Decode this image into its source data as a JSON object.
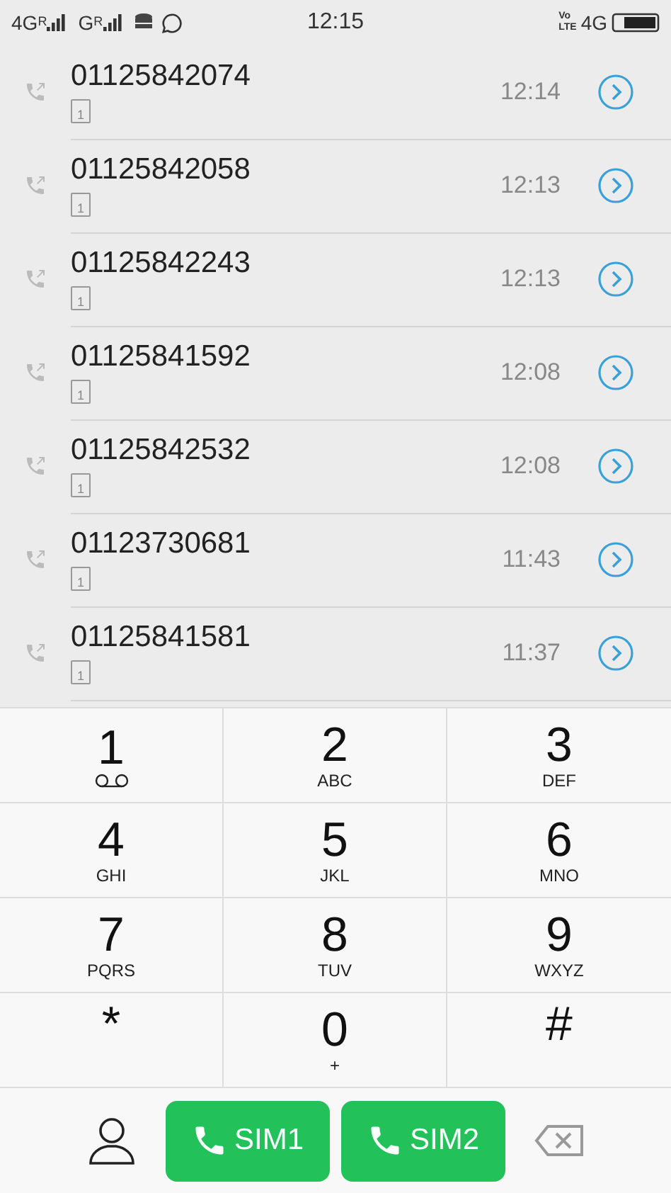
{
  "status_bar": {
    "networks": [
      {
        "type": "4G",
        "roaming": "R"
      },
      {
        "type": "G",
        "roaming": "R"
      }
    ],
    "time": "12:15",
    "volte": [
      "Vo",
      "LTE"
    ],
    "data_type": "4G"
  },
  "calls": [
    {
      "number": "01125842074",
      "time": "12:14",
      "sim": "1"
    },
    {
      "number": "01125842058",
      "time": "12:13",
      "sim": "1"
    },
    {
      "number": "01125842243",
      "time": "12:13",
      "sim": "1"
    },
    {
      "number": "01125841592",
      "time": "12:08",
      "sim": "1"
    },
    {
      "number": "01125842532",
      "time": "12:08",
      "sim": "1"
    },
    {
      "number": "01123730681",
      "time": "11:43",
      "sim": "1"
    },
    {
      "number": "01125841581",
      "time": "11:37",
      "sim": "1"
    }
  ],
  "keypad": [
    {
      "kind": "voicemail",
      "key": "1"
    },
    {
      "kind": "letters",
      "key": "2",
      "sub": "ABC"
    },
    {
      "kind": "letters",
      "key": "3",
      "sub": "DEF"
    },
    {
      "kind": "letters",
      "key": "4",
      "sub": "GHI"
    },
    {
      "kind": "letters",
      "key": "5",
      "sub": "JKL"
    },
    {
      "kind": "letters",
      "key": "6",
      "sub": "MNO"
    },
    {
      "kind": "letters",
      "key": "7",
      "sub": "PQRS"
    },
    {
      "kind": "letters",
      "key": "8",
      "sub": "TUV"
    },
    {
      "kind": "letters",
      "key": "9",
      "sub": "WXYZ"
    },
    {
      "kind": "symbol",
      "key": "*"
    },
    {
      "kind": "letters",
      "key": "0",
      "sub": "+"
    },
    {
      "kind": "symbol",
      "key": "#"
    }
  ],
  "call_buttons": [
    {
      "label": "SIM1"
    },
    {
      "label": "SIM2"
    }
  ]
}
